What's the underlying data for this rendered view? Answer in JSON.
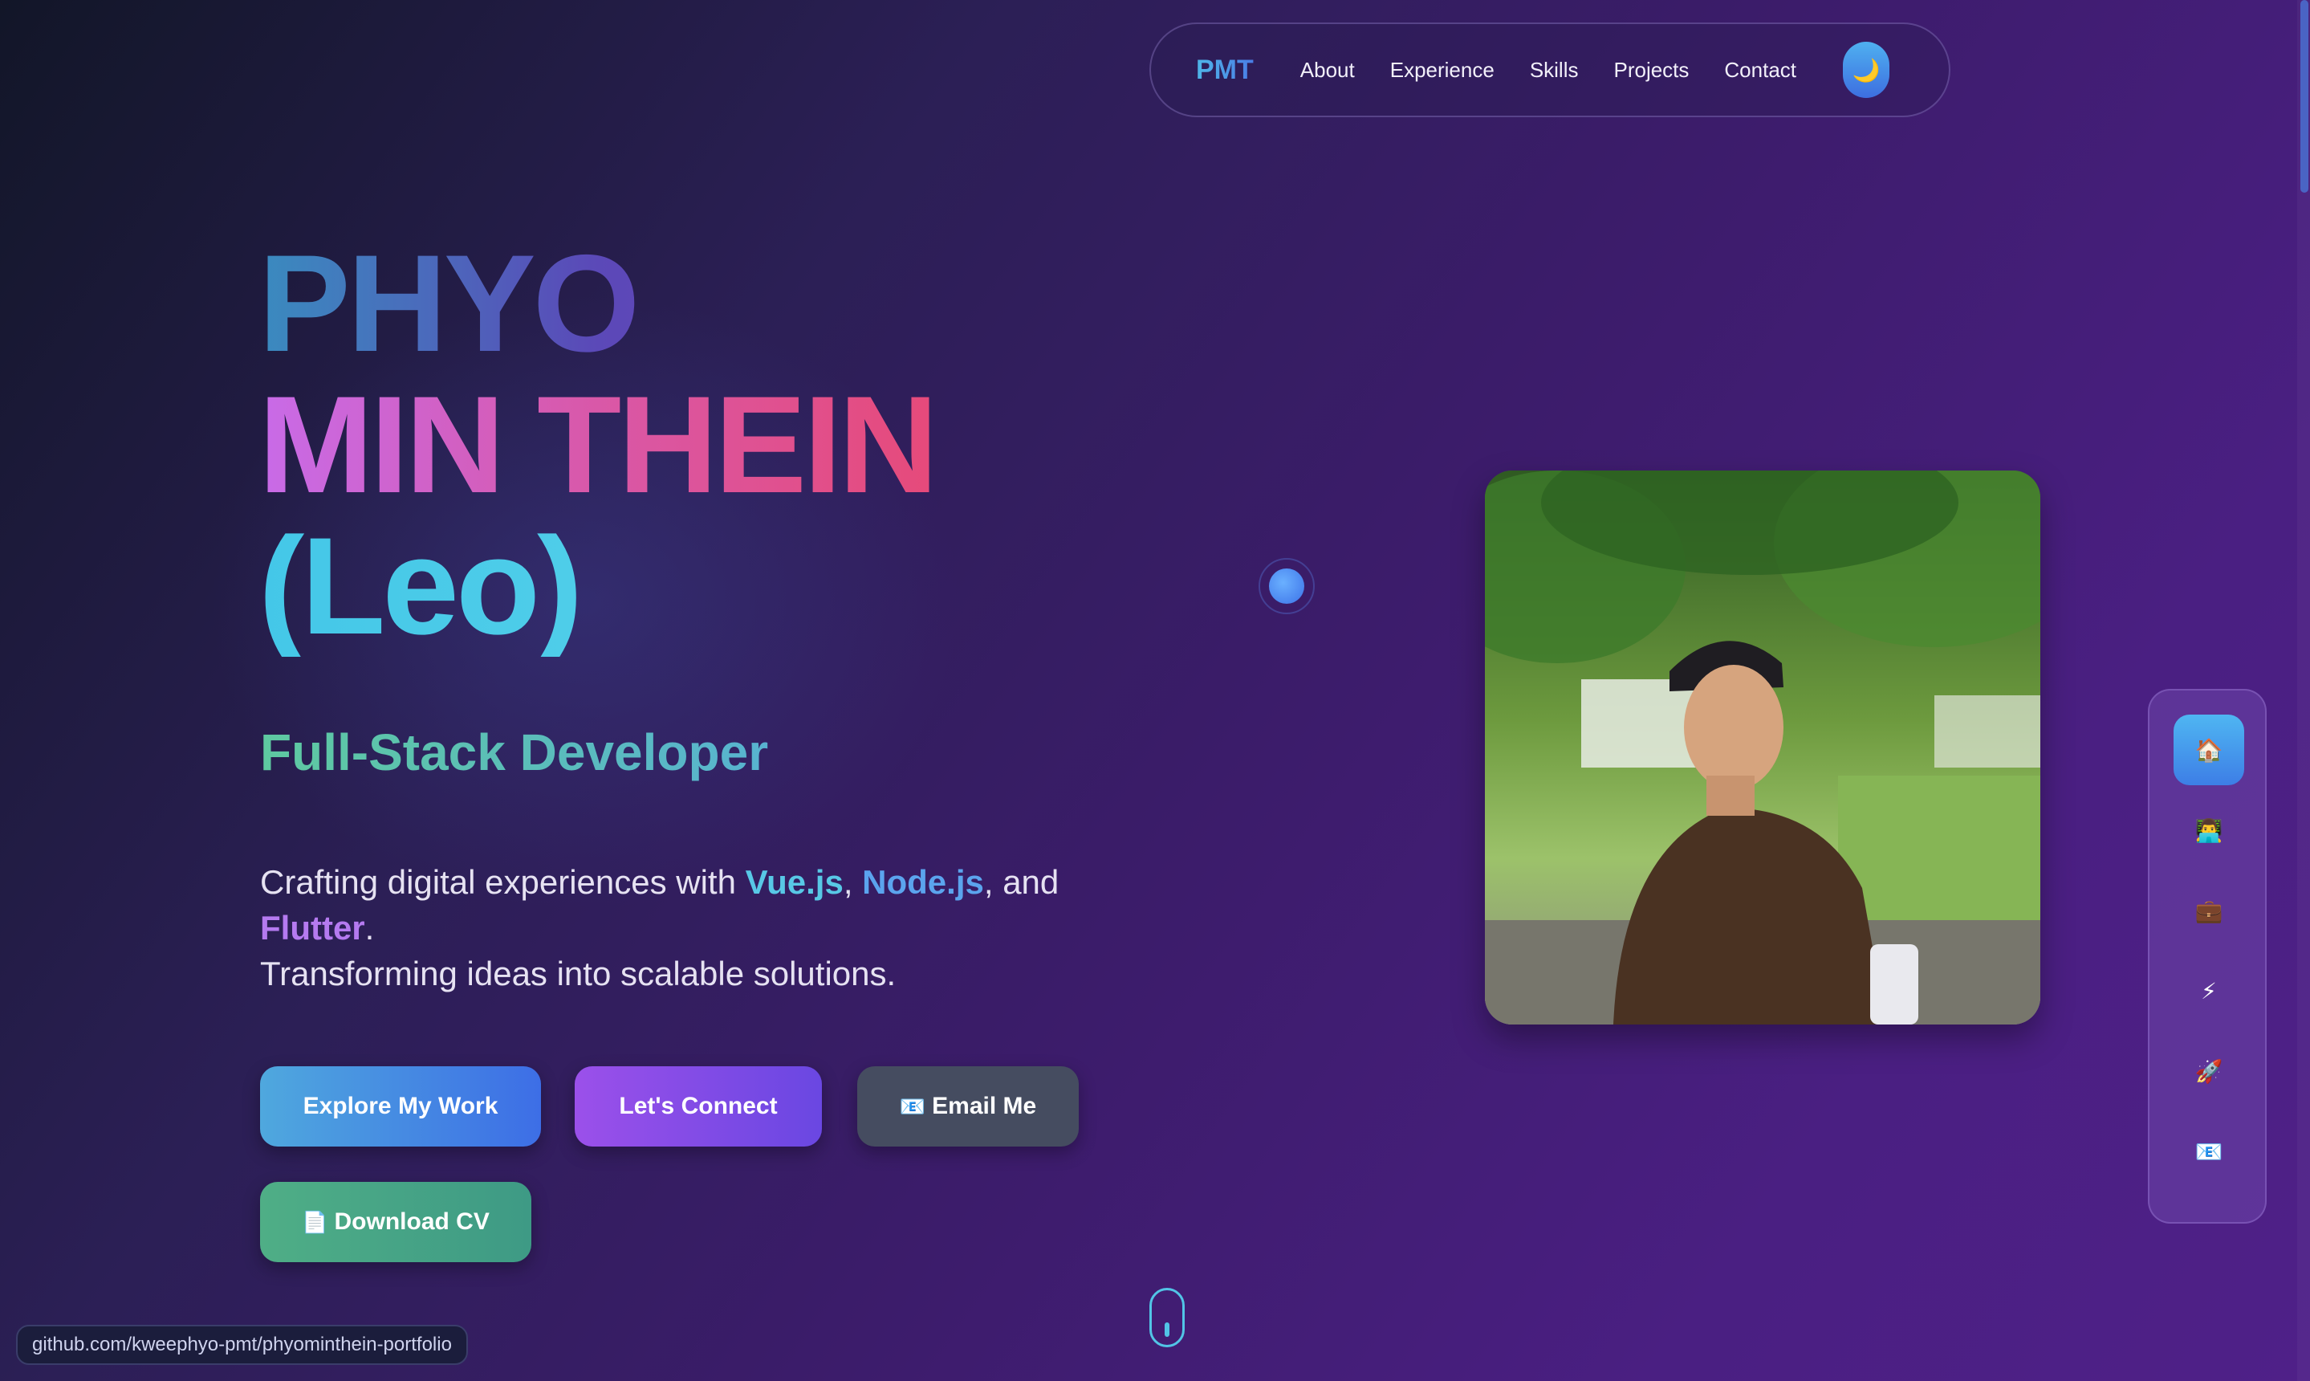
{
  "nav": {
    "logo": "PMT",
    "links": [
      "About",
      "Experience",
      "Skills",
      "Projects",
      "Contact"
    ],
    "theme_icon": "🌙"
  },
  "hero": {
    "name_line1": "PHYO",
    "name_line2": "MIN THEIN",
    "name_line3": "(Leo)",
    "role": "Full-Stack Developer",
    "desc_prefix": "Crafting digital experiences with ",
    "tech1": "Vue.js",
    "sep1": ", ",
    "tech2": "Node.js",
    "sep2": ", and ",
    "tech3": "Flutter",
    "period": ".",
    "desc_line2": "Transforming ideas into scalable solutions."
  },
  "buttons": {
    "explore": "Explore My Work",
    "connect": "Let's Connect",
    "email_icon": "📧",
    "email": "Email Me",
    "cv_icon": "📄",
    "cv": "Download CV"
  },
  "sidenav": {
    "items": [
      {
        "icon": "🏠",
        "name": "home"
      },
      {
        "icon": "👨‍💻",
        "name": "about"
      },
      {
        "icon": "💼",
        "name": "experience"
      },
      {
        "icon": "⚡",
        "name": "skills"
      },
      {
        "icon": "🚀",
        "name": "projects"
      },
      {
        "icon": "📧",
        "name": "contact"
      }
    ]
  },
  "status_url": "github.com/kweephyo-pmt/phyominthein-portfolio"
}
